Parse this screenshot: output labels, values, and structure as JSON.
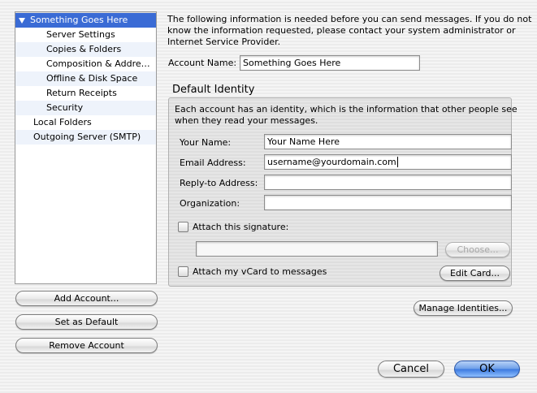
{
  "sidebar": {
    "items": [
      {
        "label": "Something Goes Here",
        "level": 0,
        "selected": true
      },
      {
        "label": "Server Settings",
        "level": 1
      },
      {
        "label": "Copies & Folders",
        "level": 1
      },
      {
        "label": "Composition & Addressing",
        "level": 1
      },
      {
        "label": "Offline & Disk Space",
        "level": 1
      },
      {
        "label": "Return Receipts",
        "level": 1
      },
      {
        "label": "Security",
        "level": 1
      },
      {
        "label": "Local Folders",
        "level": 0
      },
      {
        "label": "Outgoing Server (SMTP)",
        "level": 0
      }
    ],
    "buttons": {
      "add_account": "Add Account...",
      "set_default": "Set as Default",
      "remove_account": "Remove Account"
    }
  },
  "main": {
    "intro_line1": "The following information is needed before you can send messages. If you do not",
    "intro_line2": "know the information requested, please contact your system administrator or",
    "intro_line3": "Internet Service Provider.",
    "account_name_label": "Account Name:",
    "account_name_value": "Something Goes Here",
    "identity": {
      "title": "Default Identity",
      "desc_line1": "Each account has an identity, which is the information that other people see",
      "desc_line2": "when they read your messages.",
      "your_name_label": "Your Name:",
      "your_name_value": "Your Name Here",
      "email_label": "Email Address:",
      "email_value": "username@yourdomain.com",
      "reply_to_label": "Reply-to Address:",
      "reply_to_value": "",
      "organization_label": "Organization:",
      "organization_value": "",
      "attach_signature_label": "Attach this signature:",
      "signature_path": "",
      "choose_button": "Choose...",
      "attach_vcard_label": "Attach my vCard to messages",
      "edit_card_button": "Edit Card..."
    },
    "manage_identities_button": "Manage Identities..."
  },
  "footer": {
    "cancel": "Cancel",
    "ok": "OK"
  },
  "colors": {
    "selection": "#3a6bd5",
    "default_button": "#3a78df"
  }
}
